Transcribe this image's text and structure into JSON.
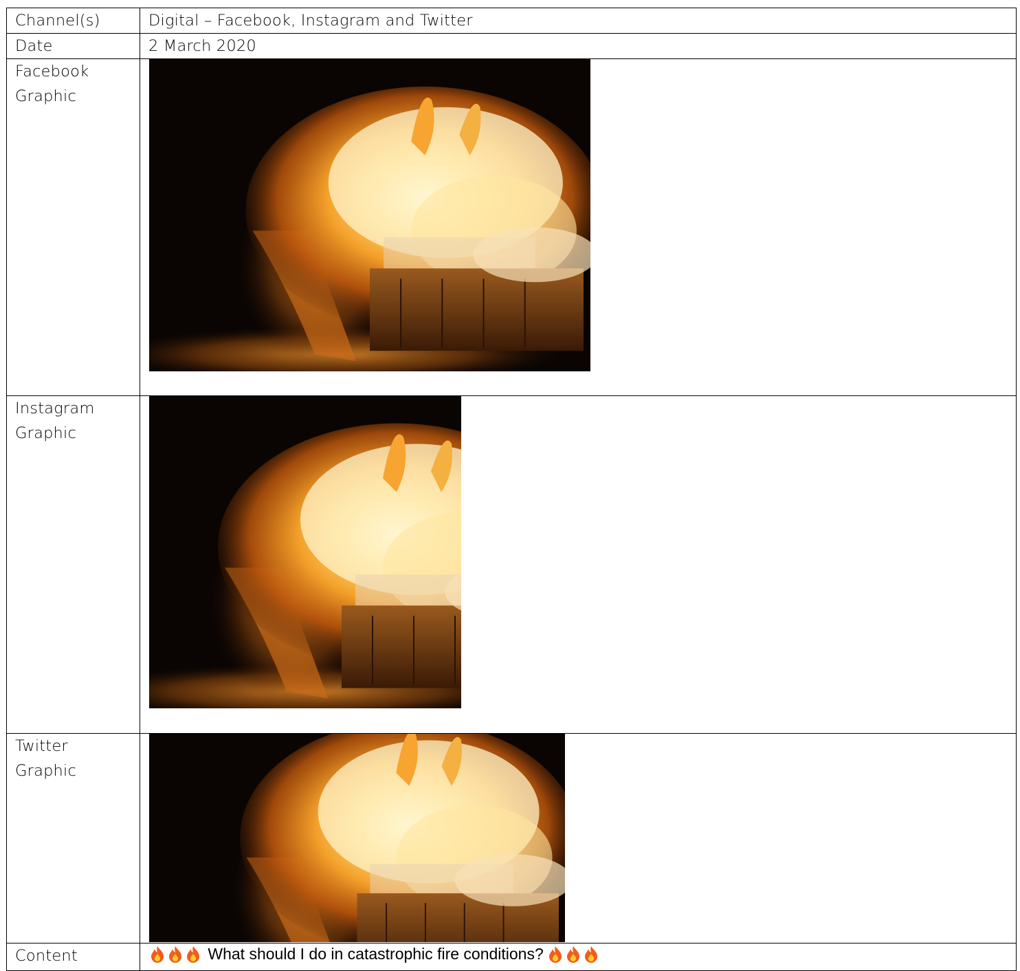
{
  "rows": {
    "channels": {
      "label": "Channel(s)",
      "value": "Digital – Facebook, Instagram and Twitter"
    },
    "date": {
      "label": "Date",
      "value": "2 March 2020"
    },
    "facebook": {
      "label_line1": "Facebook",
      "label_line2": "Graphic",
      "image": "burning-wooden-structure-photo"
    },
    "instagram": {
      "label_line1": "Instagram",
      "label_line2": "Graphic",
      "image": "burning-wooden-structure-photo"
    },
    "twitter": {
      "label_line1": "Twitter",
      "label_line2": "Graphic",
      "image": "burning-wooden-structure-photo"
    },
    "content": {
      "label": "Content",
      "text": "What should I do in catastrophic fire conditions?",
      "leading_icons": [
        "fire-emoji",
        "fire-emoji",
        "fire-emoji"
      ],
      "trailing_icons": [
        "fire-emoji",
        "fire-emoji",
        "fire-emoji"
      ]
    }
  },
  "colors": {
    "border": "#000000",
    "fire_core": "#fff1c2",
    "fire_mid": "#f6a623",
    "fire_outer": "#c75a0a",
    "night": "#0a0503"
  }
}
